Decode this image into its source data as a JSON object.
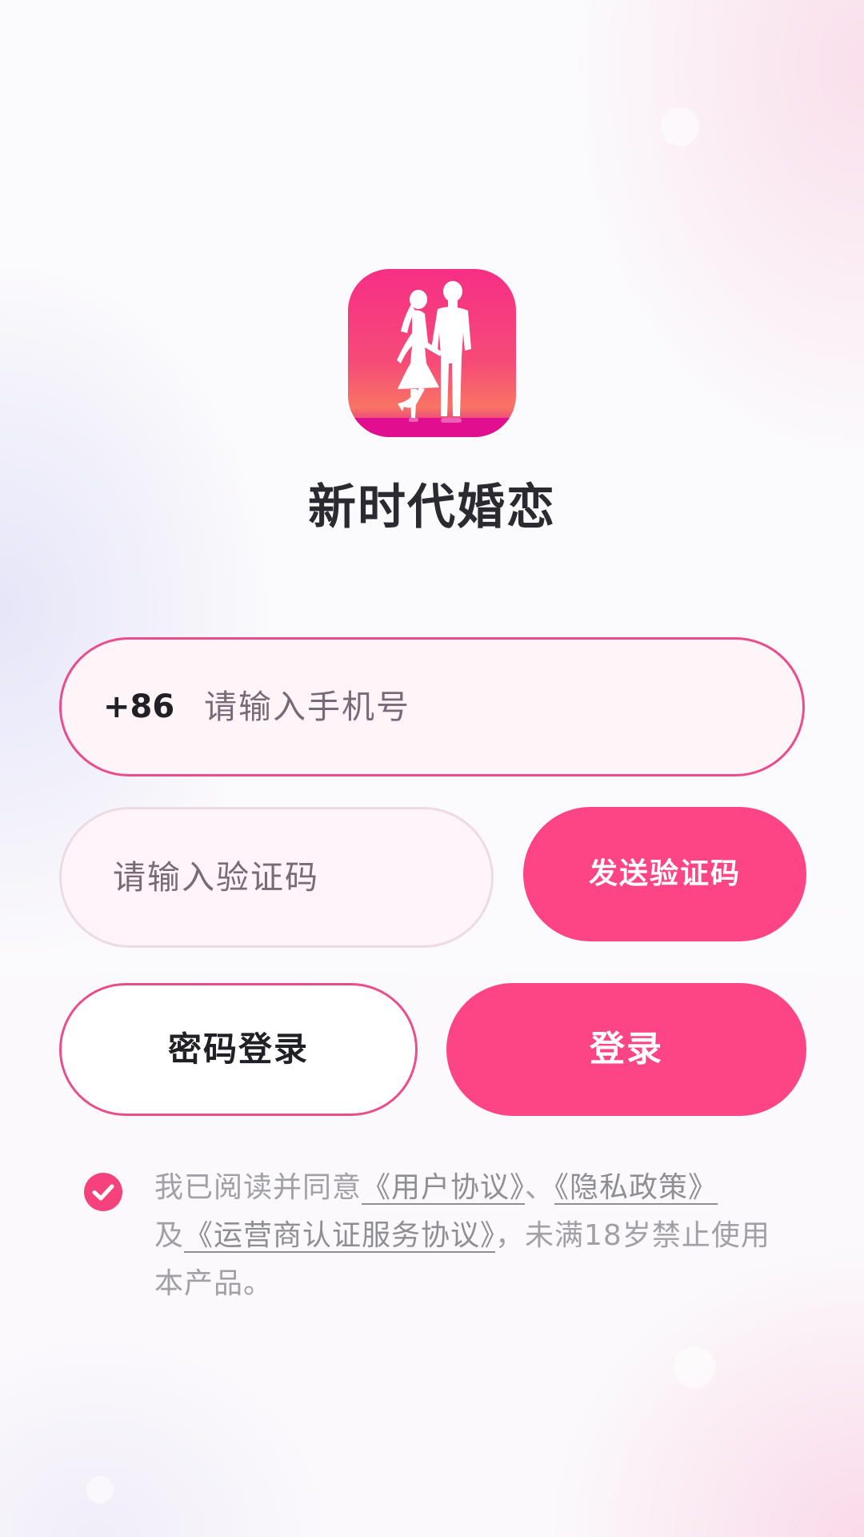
{
  "app": {
    "name": "新时代婚恋",
    "logo_icon": "couple-silhouette-icon"
  },
  "phone": {
    "country_code": "+86",
    "placeholder": "请输入手机号",
    "value": ""
  },
  "verification": {
    "placeholder": "请输入验证码",
    "value": "",
    "send_button_label": "发送验证码"
  },
  "actions": {
    "password_login_label": "密码登录",
    "login_label": "登录"
  },
  "agreement": {
    "checked": true,
    "prefix": "我已阅读并同意",
    "user_agreement": "《用户协议》",
    "separator": "、",
    "privacy_policy": "《隐私政策》",
    "conjunction": "及",
    "operator_agreement": "《运营商认证服务协议》",
    "suffix": "，未满18岁禁止使用本产品。"
  },
  "colors": {
    "accent": "#fd4586",
    "border_accent": "#ea4d8c",
    "title_text": "#2b2a30",
    "muted_text": "#a1a0a6"
  }
}
